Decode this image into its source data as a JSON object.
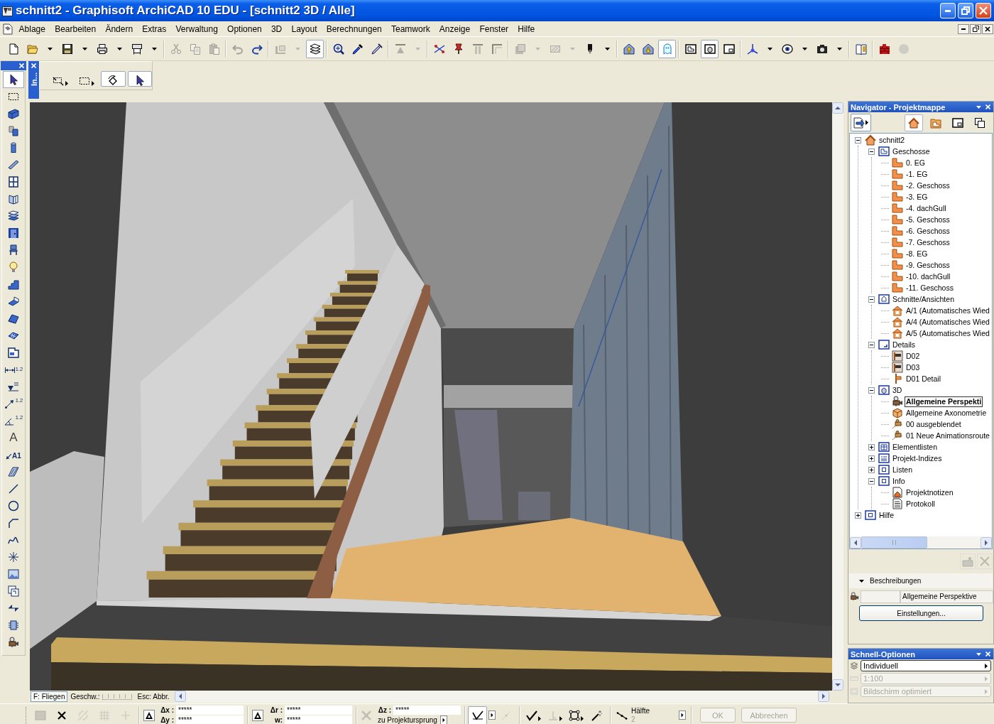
{
  "window": {
    "title": "schnitt2 - Graphisoft ArchiCAD 10 EDU - [schnitt2 3D / Alle]"
  },
  "menu_bar": {
    "items": [
      "Ablage",
      "Bearbeiten",
      "Ändern",
      "Extras",
      "Verwaltung",
      "Optionen",
      "3D",
      "Layout",
      "Berechnungen",
      "Teamwork",
      "Anzeige",
      "Fenster",
      "Hilfe"
    ]
  },
  "toolbar": {
    "groups": [
      {
        "buttons": [
          {
            "kind": "page",
            "pressed": false,
            "disabled": false
          },
          {
            "kind": "folder",
            "pressed": false,
            "disabled": false,
            "dropdown": true
          },
          {
            "kind": "disk",
            "pressed": false,
            "disabled": false,
            "dropdown": true
          },
          {
            "kind": "printer",
            "pressed": false,
            "disabled": false,
            "dropdown": true
          },
          {
            "kind": "plotter",
            "pressed": false,
            "disabled": false,
            "dropdown": true
          }
        ]
      },
      {
        "buttons": [
          {
            "kind": "scissors",
            "pressed": false,
            "disabled": true
          },
          {
            "kind": "copy",
            "pressed": false,
            "disabled": true
          },
          {
            "kind": "clipboard",
            "pressed": false,
            "disabled": true
          }
        ]
      },
      {
        "buttons": [
          {
            "kind": "undo",
            "pressed": false,
            "disabled": true
          },
          {
            "kind": "redo",
            "pressed": false,
            "disabled": false
          }
        ]
      },
      {
        "buttons": [
          {
            "kind": "bracket",
            "pressed": false,
            "disabled": true,
            "dropdown": true
          },
          {
            "kind": "layers",
            "pressed": true,
            "disabled": false
          }
        ]
      },
      {
        "buttons": [
          {
            "kind": "magnifier",
            "pressed": false,
            "disabled": false
          },
          {
            "kind": "eyedropper",
            "pressed": false,
            "disabled": false
          },
          {
            "kind": "syringe",
            "pressed": false,
            "disabled": false
          }
        ]
      },
      {
        "buttons": [
          {
            "kind": "aligntop",
            "pressed": false,
            "disabled": true,
            "dropdown": true
          }
        ]
      },
      {
        "buttons": [
          {
            "kind": "crossing",
            "pressed": false,
            "disabled": false
          },
          {
            "kind": "pin",
            "pressed": false,
            "disabled": false
          },
          {
            "kind": "columns",
            "pressed": false,
            "disabled": true
          },
          {
            "kind": "corner",
            "pressed": false,
            "disabled": true
          }
        ]
      },
      {
        "buttons": [
          {
            "kind": "stack",
            "pressed": false,
            "disabled": true,
            "dropdown": true
          },
          {
            "kind": "hatch",
            "pressed": false,
            "disabled": true,
            "dropdown": true
          },
          {
            "kind": "pen",
            "pressed": false,
            "disabled": false,
            "dropdown": true
          }
        ]
      },
      {
        "buttons": [
          {
            "kind": "houseup",
            "pressed": false,
            "disabled": false
          },
          {
            "kind": "housedown",
            "pressed": false,
            "disabled": false
          },
          {
            "kind": "ghost",
            "pressed": true,
            "disabled": false
          }
        ]
      },
      {
        "buttons": [
          {
            "kind": "plan",
            "pressed": false,
            "disabled": false
          },
          {
            "kind": "window3d",
            "pressed": true,
            "disabled": false
          },
          {
            "kind": "sheet",
            "pressed": false,
            "disabled": false
          }
        ]
      },
      {
        "buttons": [
          {
            "kind": "axes",
            "pressed": false,
            "disabled": false,
            "dropdown": true
          },
          {
            "kind": "eye",
            "pressed": false,
            "disabled": false,
            "dropdown": true
          },
          {
            "kind": "camera",
            "pressed": false,
            "disabled": false,
            "dropdown": true
          }
        ]
      },
      {
        "buttons": [
          {
            "kind": "book",
            "pressed": false,
            "disabled": false
          }
        ]
      },
      {
        "buttons": [
          {
            "kind": "bricks",
            "pressed": false,
            "disabled": false
          },
          {
            "kind": "dot",
            "pressed": false,
            "disabled": true
          }
        ]
      }
    ]
  },
  "toolbox": {
    "tools": [
      {
        "kind": "pointer",
        "selected": true
      },
      {
        "kind": "marquee",
        "selected": false
      },
      {
        "kind": "wall",
        "selected": false
      },
      {
        "kind": "blocks",
        "selected": false
      },
      {
        "kind": "cylinder",
        "selected": false
      },
      {
        "kind": "beam",
        "selected": false
      },
      {
        "kind": "window",
        "selected": false
      },
      {
        "kind": "cornerwindow",
        "selected": false
      },
      {
        "kind": "slab",
        "selected": false
      },
      {
        "kind": "door",
        "selected": false
      },
      {
        "kind": "chair",
        "selected": false
      },
      {
        "kind": "lamp",
        "selected": false
      },
      {
        "kind": "stair",
        "selected": false
      },
      {
        "kind": "shell",
        "selected": false
      },
      {
        "kind": "roof",
        "selected": false
      },
      {
        "kind": "mesh",
        "selected": false
      },
      {
        "kind": "zone",
        "selected": false
      },
      {
        "kind": "dimension",
        "selected": false,
        "text": "1.2"
      },
      {
        "kind": "level",
        "selected": false
      },
      {
        "kind": "radial",
        "selected": false,
        "text": "1.2"
      },
      {
        "kind": "angle",
        "selected": false,
        "text": "1.2"
      },
      {
        "kind": "text",
        "selected": false,
        "text": "A"
      },
      {
        "kind": "label",
        "selected": false,
        "text": "A1"
      },
      {
        "kind": "fill",
        "selected": false
      },
      {
        "kind": "line",
        "selected": false
      },
      {
        "kind": "circle",
        "selected": false
      },
      {
        "kind": "polyline",
        "selected": false
      },
      {
        "kind": "spline",
        "selected": false
      },
      {
        "kind": "hotspot",
        "selected": false
      },
      {
        "kind": "figure",
        "selected": false
      },
      {
        "kind": "drawing",
        "selected": false
      },
      {
        "kind": "section",
        "selected": false
      },
      {
        "kind": "elevation",
        "selected": false
      },
      {
        "kind": "moviecam",
        "selected": false
      }
    ]
  },
  "info_box": {
    "title": "In...",
    "tools": [
      {
        "kind": "pick",
        "pressed": false,
        "flyout": true
      },
      {
        "kind": "marquee",
        "pressed": false,
        "flyout": true
      },
      {
        "kind": "rotate",
        "pressed": true
      },
      {
        "kind": "pointer",
        "pressed": true
      }
    ]
  },
  "viewport": {
    "status": {
      "mode": "F: Fliegen",
      "speed_label": "Geschw.:",
      "escape_hint": "Esc: Abbr."
    }
  },
  "navigator": {
    "title": "Navigator - Projektmappe",
    "tabs": [
      {
        "kind": "house",
        "selected": true
      },
      {
        "kind": "binder",
        "selected": false
      },
      {
        "kind": "sheet",
        "selected": false
      },
      {
        "kind": "pages",
        "selected": false
      }
    ],
    "tree": [
      {
        "label": "schnitt2",
        "kind": "house",
        "selected": false,
        "expanded": true,
        "children": [
          {
            "label": "Geschosse",
            "kind": "framel",
            "selected": false,
            "expanded": true,
            "children": [
              {
                "label": "0. EG",
                "kind": "story",
                "selected": false
              },
              {
                "label": "-1. EG",
                "kind": "story",
                "selected": false
              },
              {
                "label": "-2. Geschoss",
                "kind": "story",
                "selected": false
              },
              {
                "label": "-3. EG",
                "kind": "story",
                "selected": false
              },
              {
                "label": "-4. dachGull",
                "kind": "story",
                "selected": false
              },
              {
                "label": "-5. Geschoss",
                "kind": "story",
                "selected": false
              },
              {
                "label": "-6. Geschoss",
                "kind": "story",
                "selected": false
              },
              {
                "label": "-7. Geschoss",
                "kind": "story",
                "selected": false
              },
              {
                "label": "-8. EG",
                "kind": "story",
                "selected": false
              },
              {
                "label": "-9. Geschoss",
                "kind": "story",
                "selected": false
              },
              {
                "label": "-10. dachGull",
                "kind": "story",
                "selected": false
              },
              {
                "label": "-11. Geschoss",
                "kind": "story",
                "selected": false
              }
            ]
          },
          {
            "label": "Schnitte/Ansichten",
            "kind": "framehouse",
            "selected": false,
            "expanded": true,
            "children": [
              {
                "label": "A/1 (Automatisches Wied",
                "kind": "section",
                "selected": false
              },
              {
                "label": "A/4 (Automatisches Wied",
                "kind": "section",
                "selected": false
              },
              {
                "label": "A/5 (Automatisches Wied",
                "kind": "section",
                "selected": false
              }
            ]
          },
          {
            "label": "Details",
            "kind": "framecorner",
            "selected": false,
            "expanded": true,
            "children": [
              {
                "label": "D02",
                "kind": "detail",
                "selected": false
              },
              {
                "label": "D03",
                "kind": "detail",
                "selected": false
              },
              {
                "label": "D01 Detail",
                "kind": "marker",
                "selected": false
              }
            ]
          },
          {
            "label": "3D",
            "kind": "framecube",
            "selected": false,
            "expanded": true,
            "children": [
              {
                "label": "Allgemeine Perspekti",
                "kind": "moviecam",
                "selected": true
              },
              {
                "label": "Allgemeine Axonometrie",
                "kind": "box",
                "selected": false
              },
              {
                "label": "00 ausgeblendet",
                "kind": "animation",
                "selected": false
              },
              {
                "label": "01 Neue Animationsroute",
                "kind": "animation",
                "selected": false
              }
            ]
          },
          {
            "label": "Elementlisten",
            "kind": "framegrid",
            "selected": false,
            "expanded": false
          },
          {
            "label": "Projekt-Indizes",
            "kind": "framelist",
            "selected": false,
            "expanded": false
          },
          {
            "label": "Listen",
            "kind": "frame",
            "selected": false,
            "expanded": false
          },
          {
            "label": "Info",
            "kind": "frame",
            "selected": false,
            "expanded": true,
            "children": [
              {
                "label": "Projektnotizen",
                "kind": "note",
                "selected": false
              },
              {
                "label": "Protokoll",
                "kind": "log",
                "selected": false
              }
            ]
          }
        ]
      },
      {
        "label": "Hilfe",
        "kind": "frame",
        "selected": false,
        "expanded": false
      }
    ],
    "actions": [
      {
        "kind": "newitem",
        "disabled": true
      },
      {
        "kind": "delete",
        "disabled": true
      }
    ],
    "descriptions": {
      "label": "Beschreibungen",
      "expanded": true,
      "name": "Allgemeine Perspektive",
      "button": "Einstellungen..."
    }
  },
  "quick_options": {
    "title": "Schnell-Optionen",
    "rows": [
      {
        "kind": "layerset",
        "value": "Individuell",
        "disabled": false
      },
      {
        "kind": "ruler",
        "value": "1:100",
        "disabled": true
      },
      {
        "kind": "screen",
        "value": "Bildschirm optimiert",
        "disabled": true
      }
    ]
  },
  "control_box": {
    "tools": [
      {
        "kind": "square",
        "disabled": true
      },
      {
        "kind": "cross",
        "disabled": false
      },
      {
        "kind": "diagonal",
        "disabled": true
      },
      {
        "kind": "gridlines",
        "disabled": true
      },
      {
        "kind": "plus",
        "disabled": true
      }
    ],
    "coordinates": [
      {
        "kind": "toggle",
        "rows": [
          {
            "label": "Δx :",
            "value": "*****"
          },
          {
            "label": "Δy :",
            "value": "*****"
          }
        ]
      },
      {
        "kind": "toggle",
        "rows": [
          {
            "label": "Δr :",
            "value": "*****"
          },
          {
            "label": "w:",
            "value": "*****"
          }
        ]
      },
      {
        "kind": "origin",
        "rows": [
          {
            "label": "Δz :",
            "value": "*****"
          }
        ],
        "link": "zu Projektursprung"
      }
    ],
    "snap_tools": [
      {
        "kind": "tickcorner",
        "pressed": true,
        "disabled": false,
        "menu": true
      },
      {
        "kind": "guide",
        "pressed": false,
        "disabled": true
      },
      {
        "kind": "check",
        "pressed": false,
        "disabled": false,
        "flyout": true
      },
      {
        "kind": "perpendicular",
        "pressed": false,
        "disabled": true,
        "flyout": true
      },
      {
        "kind": "nodes",
        "pressed": false,
        "disabled": false,
        "flyout": true
      },
      {
        "kind": "wand",
        "pressed": false,
        "disabled": false
      }
    ],
    "snap": {
      "kind": "segment",
      "label": "Hälfte",
      "value": "2"
    },
    "buttons": [
      {
        "label": "OK",
        "disabled": true
      },
      {
        "label": "Abbrechen",
        "disabled": true
      }
    ]
  }
}
